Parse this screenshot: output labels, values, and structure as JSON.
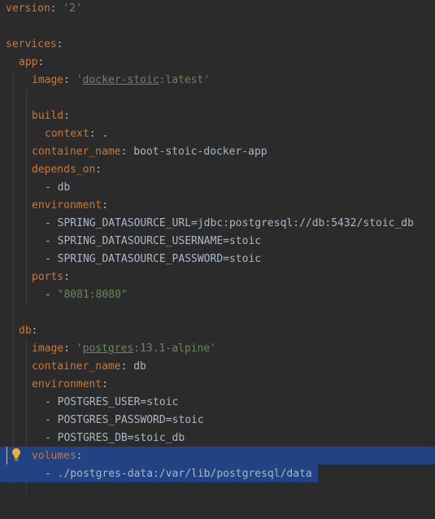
{
  "editor": {
    "lines": [
      {
        "k": "version",
        "colon": ": ",
        "v": "'2'"
      },
      {},
      {
        "k": "services",
        "colon": ":"
      },
      {
        "k": "app",
        "colon": ":"
      },
      {
        "k": "image",
        "colon": ": ",
        "q1": "'",
        "link": "docker-stoic",
        "rest": ":latest'"
      },
      {},
      {
        "k": "build",
        "colon": ":"
      },
      {
        "k": "context",
        "colon": ": ",
        "plain": "."
      },
      {
        "k": "container_name",
        "colon": ": ",
        "plain": "boot-stoic-docker-app"
      },
      {
        "k": "depends_on",
        "colon": ":"
      },
      {
        "dash": "- ",
        "plain": "db"
      },
      {
        "k": "environment",
        "colon": ":"
      },
      {
        "dash": "- ",
        "plain": "SPRING_DATASOURCE_URL=jdbc:postgresql://db:5432/stoic_db"
      },
      {
        "dash": "- ",
        "plain": "SPRING_DATASOURCE_USERNAME=stoic"
      },
      {
        "dash": "- ",
        "plain": "SPRING_DATASOURCE_PASSWORD=stoic"
      },
      {
        "k": "ports",
        "colon": ":"
      },
      {
        "dash": "- ",
        "str": "\"8081:8080\""
      },
      {},
      {
        "k": "db",
        "colon": ":"
      },
      {
        "k": "image",
        "colon": ": ",
        "q1": "'",
        "link": "postgres",
        "rest": ":13.1-alpine'"
      },
      {
        "k": "container_name",
        "colon": ": ",
        "plain": "db"
      },
      {
        "k": "environment",
        "colon": ":"
      },
      {
        "dash": "- ",
        "plain": "POSTGRES_USER=stoic"
      },
      {
        "dash": "- ",
        "plain": "POSTGRES_PASSWORD=stoic"
      },
      {
        "dash": "- ",
        "plain": "POSTGRES_DB=stoic_db"
      },
      {
        "k": "volumes",
        "colon": ":"
      },
      {
        "dash": "- ",
        "plain": "./postgres-data:/var/lib/postgresql/data"
      }
    ]
  },
  "icons": {
    "intention": "lightbulb-icon"
  },
  "colors": {
    "background": "#2b2b2b",
    "key": "#cc7832",
    "string": "#6a8759",
    "text": "#a9b7c6",
    "selection": "#214283",
    "bulb": "#f0b429"
  }
}
